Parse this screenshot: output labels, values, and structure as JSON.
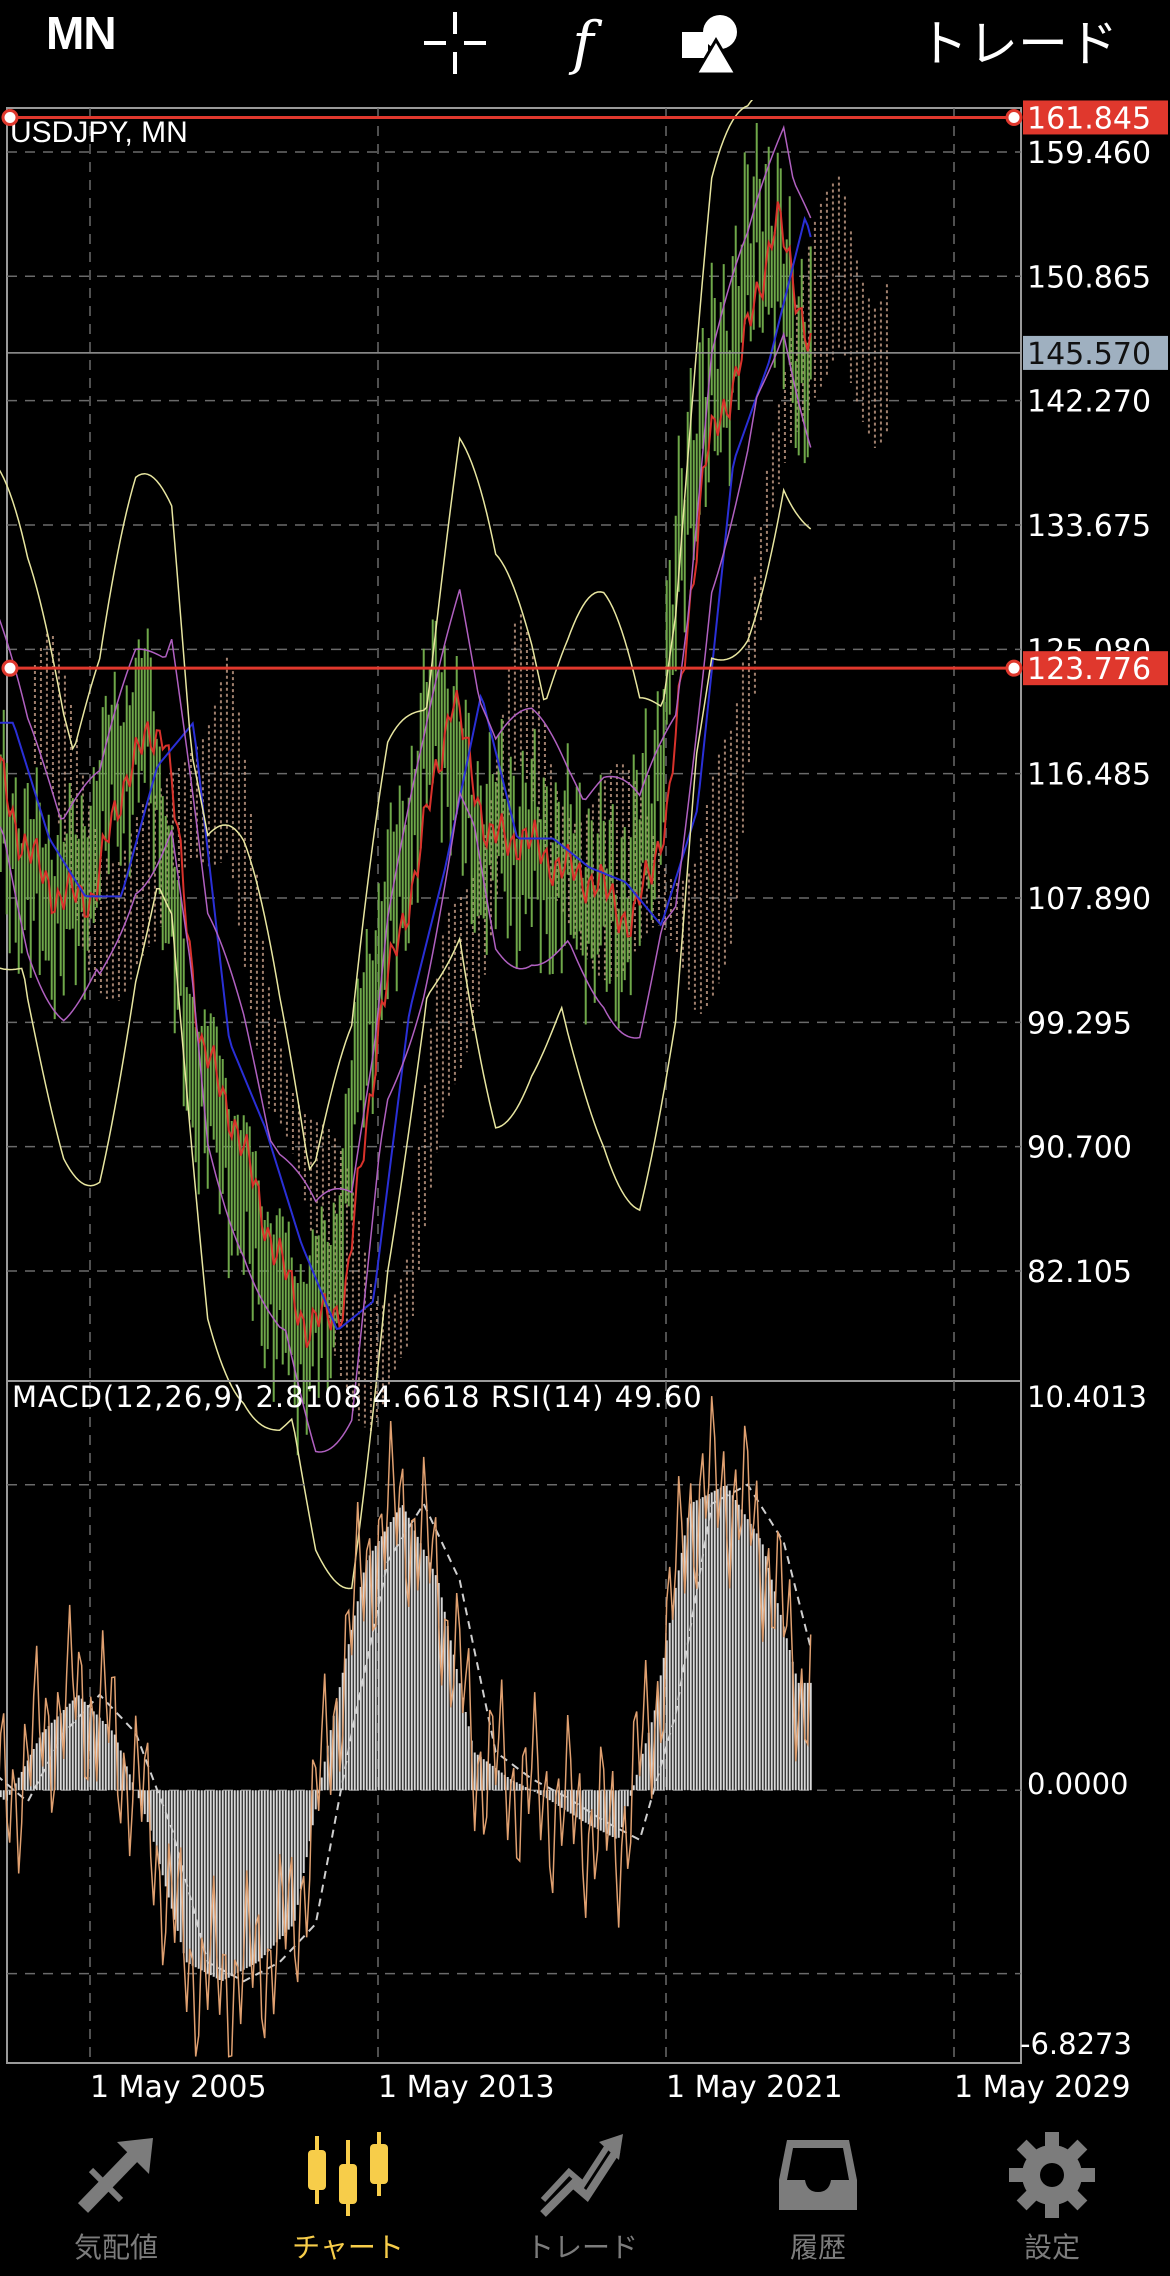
{
  "topbar": {
    "timeframe": "MN",
    "crosshair_icon": "crosshair-icon",
    "indicators_icon": "function-icon",
    "objects_icon": "shapes-icon",
    "trade_label": "トレード"
  },
  "main_chart": {
    "symbol_label": "USDJPY, MN",
    "price_levels": [
      "159.460",
      "150.865",
      "142.270",
      "133.675",
      "125.080",
      "116.485",
      "107.890",
      "99.295",
      "90.700",
      "82.105"
    ],
    "hlines": [
      {
        "label": "161.845",
        "price": 161.845,
        "color": "#e0382d"
      },
      {
        "label": "123.776",
        "price": 123.776,
        "color": "#e0382d"
      }
    ],
    "current_price": {
      "label": "145.570",
      "price": 145.57
    },
    "colors": {
      "candle": "#6fa84a",
      "ma_fast": "#d9322b",
      "ma_slow": "#2a2fd6",
      "bands_outer": "#e8e6a0",
      "bands_inner": "#b060c0",
      "cloud": "#c9a08a"
    }
  },
  "sub_chart": {
    "indicator_label": "MACD(12,26,9) 2.8108 4.6618 RSI(14) 49.60",
    "levels": [
      "10.4013",
      "0.0000",
      "-6.8273"
    ],
    "colors": {
      "histogram": "#d8d8d8",
      "rsi": "#e0a070",
      "signal": "#cfcfcf"
    }
  },
  "x_axis": [
    "1 May 2005",
    "1 May 2013",
    "1 May 2021",
    "1 May 2029"
  ],
  "chart_data": {
    "type": "line",
    "title": "USDJPY, MN",
    "x_ticks": [
      "1 May 2005",
      "1 May 2013",
      "1 May 2021",
      "1 May 2029"
    ],
    "ylim": [
      74.5,
      162.5
    ],
    "y_ticks": [
      159.46,
      150.865,
      142.27,
      133.675,
      125.08,
      116.485,
      107.89,
      99.295,
      90.7,
      82.105
    ],
    "horizontal_lines": [
      161.845,
      123.776
    ],
    "last_price": 145.57,
    "price_series": [
      {
        "x": "2002",
        "y": 120
      },
      {
        "x": "2003",
        "y": 112
      },
      {
        "x": "2004",
        "y": 108
      },
      {
        "x": "2005",
        "y": 108
      },
      {
        "x": "2006",
        "y": 117
      },
      {
        "x": "2007",
        "y": 120
      },
      {
        "x": "2008",
        "y": 98
      },
      {
        "x": "2009",
        "y": 92
      },
      {
        "x": "2010",
        "y": 84
      },
      {
        "x": "2011",
        "y": 78
      },
      {
        "x": "2012",
        "y": 80
      },
      {
        "x": "2013",
        "y": 100
      },
      {
        "x": "2014",
        "y": 110
      },
      {
        "x": "2015",
        "y": 122
      },
      {
        "x": "2016",
        "y": 112
      },
      {
        "x": "2017",
        "y": 112
      },
      {
        "x": "2018",
        "y": 110
      },
      {
        "x": "2019",
        "y": 109
      },
      {
        "x": "2020",
        "y": 106
      },
      {
        "x": "2021",
        "y": 114
      },
      {
        "x": "2022",
        "y": 138
      },
      {
        "x": "2023",
        "y": 145
      },
      {
        "x": "2024",
        "y": 155
      },
      {
        "x": "2025",
        "y": 145.57
      }
    ],
    "macd": {
      "ylim": [
        -6.8273,
        10.4013
      ],
      "values": [
        {
          "x": "2002",
          "y": 0.5
        },
        {
          "x": "2003",
          "y": -0.3
        },
        {
          "x": "2004",
          "y": 1.5
        },
        {
          "x": "2005",
          "y": 2.5
        },
        {
          "x": "2006",
          "y": 1.5
        },
        {
          "x": "2007",
          "y": -1.0
        },
        {
          "x": "2008",
          "y": -4.5
        },
        {
          "x": "2009",
          "y": -5.0
        },
        {
          "x": "2010",
          "y": -4.5
        },
        {
          "x": "2011",
          "y": -3.5
        },
        {
          "x": "2012",
          "y": 1.5
        },
        {
          "x": "2013",
          "y": 6.0
        },
        {
          "x": "2014",
          "y": 7.5
        },
        {
          "x": "2015",
          "y": 5.5
        },
        {
          "x": "2016",
          "y": 1.0
        },
        {
          "x": "2017",
          "y": 0.3
        },
        {
          "x": "2018",
          "y": -0.2
        },
        {
          "x": "2019",
          "y": -0.8
        },
        {
          "x": "2020",
          "y": -1.3
        },
        {
          "x": "2021",
          "y": 2.0
        },
        {
          "x": "2022",
          "y": 7.5
        },
        {
          "x": "2023",
          "y": 8.0
        },
        {
          "x": "2024",
          "y": 6.5
        },
        {
          "x": "2025",
          "y": 2.81
        }
      ]
    }
  },
  "tabbar": {
    "items": [
      {
        "label": "気配値",
        "icon": "quotes-icon"
      },
      {
        "label": "チャート",
        "icon": "chart-candles-icon",
        "active": true
      },
      {
        "label": "トレード",
        "icon": "trade-icon"
      },
      {
        "label": "履歴",
        "icon": "history-inbox-icon"
      },
      {
        "label": "設定",
        "icon": "settings-gear-icon"
      }
    ],
    "active_color": "#f7cd4a",
    "inactive_color": "#7c7c7c"
  }
}
